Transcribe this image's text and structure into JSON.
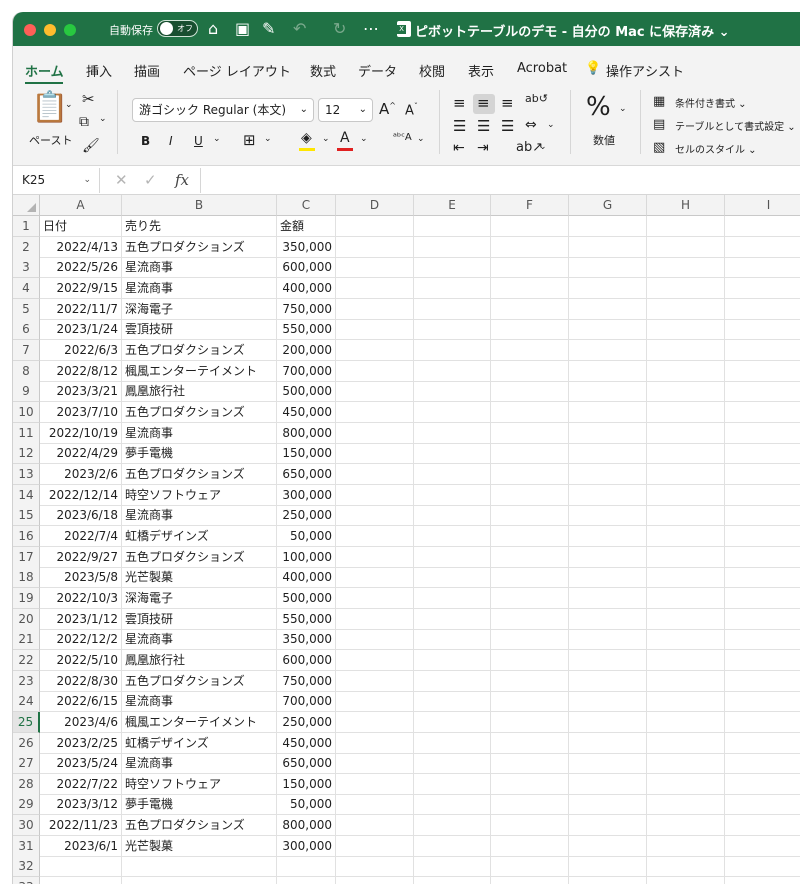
{
  "titlebar": {
    "autosave_label": "自動保存",
    "autosave_state": "オフ",
    "document_title": "ピボットテーブルのデモ - 自分の Mac に保存済み",
    "icons": [
      "home-icon",
      "save-icon",
      "save-as-icon",
      "undo-icon",
      "redo-icon",
      "more-icon"
    ]
  },
  "ribbon_tabs": [
    "ホーム",
    "挿入",
    "描画",
    "ページ レイアウト",
    "数式",
    "データ",
    "校閲",
    "表示",
    "Acrobat",
    "操作アシスト"
  ],
  "active_tab": "ホーム",
  "ribbon": {
    "paste_label": "ペースト",
    "font_name": "游ゴシック Regular (本文)",
    "font_size": "12",
    "bold": "B",
    "italic": "I",
    "underline": "U",
    "number_format_label": "数値",
    "percent_symbol": "%",
    "conditional_format": "条件付き書式",
    "format_as_table": "テーブルとして書式設定",
    "cell_styles": "セルのスタイル",
    "accent_color": "#207245"
  },
  "formula_bar": {
    "name_box": "K25",
    "cancel": "✕",
    "enter": "✓",
    "fx": "fx",
    "content": ""
  },
  "columns": [
    "A",
    "B",
    "C",
    "D",
    "E",
    "F",
    "G",
    "H",
    "I"
  ],
  "rows": [
    {
      "n": "1",
      "a": "日付",
      "b": "売り先",
      "c": "金額"
    },
    {
      "n": "2",
      "a": "2022/4/13",
      "b": "五色プロダクションズ",
      "c": "350,000"
    },
    {
      "n": "3",
      "a": "2022/5/26",
      "b": "星流商事",
      "c": "600,000"
    },
    {
      "n": "4",
      "a": "2022/9/15",
      "b": "星流商事",
      "c": "400,000"
    },
    {
      "n": "5",
      "a": "2022/11/7",
      "b": "深海電子",
      "c": "750,000"
    },
    {
      "n": "6",
      "a": "2023/1/24",
      "b": "雲頂技研",
      "c": "550,000"
    },
    {
      "n": "7",
      "a": "2022/6/3",
      "b": "五色プロダクションズ",
      "c": "200,000"
    },
    {
      "n": "8",
      "a": "2022/8/12",
      "b": "楓風エンターテイメント",
      "c": "700,000"
    },
    {
      "n": "9",
      "a": "2023/3/21",
      "b": "鳳凰旅行社",
      "c": "500,000"
    },
    {
      "n": "10",
      "a": "2023/7/10",
      "b": "五色プロダクションズ",
      "c": "450,000"
    },
    {
      "n": "11",
      "a": "2022/10/19",
      "b": "星流商事",
      "c": "800,000"
    },
    {
      "n": "12",
      "a": "2022/4/29",
      "b": "夢手電機",
      "c": "150,000"
    },
    {
      "n": "13",
      "a": "2023/2/6",
      "b": "五色プロダクションズ",
      "c": "650,000"
    },
    {
      "n": "14",
      "a": "2022/12/14",
      "b": "時空ソフトウェア",
      "c": "300,000"
    },
    {
      "n": "15",
      "a": "2023/6/18",
      "b": "星流商事",
      "c": "250,000"
    },
    {
      "n": "16",
      "a": "2022/7/4",
      "b": "虹橋デザインズ",
      "c": "50,000"
    },
    {
      "n": "17",
      "a": "2022/9/27",
      "b": "五色プロダクションズ",
      "c": "100,000"
    },
    {
      "n": "18",
      "a": "2023/5/8",
      "b": "光芒製菓",
      "c": "400,000"
    },
    {
      "n": "19",
      "a": "2022/10/3",
      "b": "深海電子",
      "c": "500,000"
    },
    {
      "n": "20",
      "a": "2023/1/12",
      "b": "雲頂技研",
      "c": "550,000"
    },
    {
      "n": "21",
      "a": "2022/12/2",
      "b": "星流商事",
      "c": "350,000"
    },
    {
      "n": "22",
      "a": "2022/5/10",
      "b": "鳳凰旅行社",
      "c": "600,000"
    },
    {
      "n": "23",
      "a": "2022/8/30",
      "b": "五色プロダクションズ",
      "c": "750,000"
    },
    {
      "n": "24",
      "a": "2022/6/15",
      "b": "星流商事",
      "c": "700,000"
    },
    {
      "n": "25",
      "a": "2023/4/6",
      "b": "楓風エンターテイメント",
      "c": "250,000"
    },
    {
      "n": "26",
      "a": "2023/2/25",
      "b": "虹橋デザインズ",
      "c": "450,000"
    },
    {
      "n": "27",
      "a": "2023/5/24",
      "b": "星流商事",
      "c": "650,000"
    },
    {
      "n": "28",
      "a": "2022/7/22",
      "b": "時空ソフトウェア",
      "c": "150,000"
    },
    {
      "n": "29",
      "a": "2023/3/12",
      "b": "夢手電機",
      "c": "50,000"
    },
    {
      "n": "30",
      "a": "2022/11/23",
      "b": "五色プロダクションズ",
      "c": "800,000"
    },
    {
      "n": "31",
      "a": "2023/6/1",
      "b": "光芒製菓",
      "c": "300,000"
    },
    {
      "n": "32",
      "a": "",
      "b": "",
      "c": ""
    },
    {
      "n": "33",
      "a": "",
      "b": "",
      "c": ""
    }
  ],
  "selected_row": "25"
}
